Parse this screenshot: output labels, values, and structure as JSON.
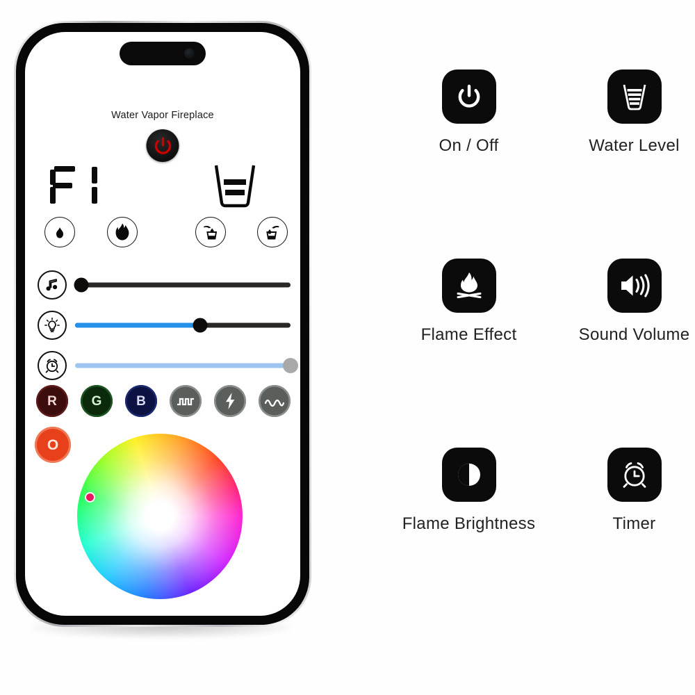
{
  "app": {
    "title": "Water Vapor Fireplace",
    "power_button": {
      "name": "power",
      "glyph": "power-icon",
      "color": "#cc0000"
    },
    "display": {
      "value": "F1",
      "type": "seven-segment"
    },
    "water_level_indicator": {
      "bars": 2,
      "max_bars": 3,
      "icon": "glass-water-level-icon"
    },
    "icon_buttons": [
      {
        "id": "flame-low",
        "icon": "small-flame-icon",
        "label": ""
      },
      {
        "id": "flame-high",
        "icon": "large-flame-icon",
        "label": ""
      },
      {
        "id": "water-decrease",
        "icon": "water-drop-into-glass-icon",
        "label": ""
      },
      {
        "id": "water-increase",
        "icon": "water-pour-out-glass-icon",
        "label": ""
      }
    ],
    "sliders": [
      {
        "id": "sound-volume",
        "icon": "music-note-icon",
        "value": 3,
        "min": 0,
        "max": 100,
        "track_color": "#2b2724",
        "fill_color": "#2490e8",
        "thumb_color": "#0d0c0b"
      },
      {
        "id": "flame-brightness",
        "icon": "light-bulb-icon",
        "value": 58,
        "min": 0,
        "max": 100,
        "track_color": "#2b2724",
        "fill_color": "#2490e8",
        "thumb_color": "#0d0c0b"
      },
      {
        "id": "timer",
        "icon": "alarm-clock-icon",
        "value": 100,
        "min": 0,
        "max": 100,
        "track_color": "#9ec4f0",
        "fill_color": "#9ec4f0",
        "thumb_color": "#a9a9a9"
      }
    ],
    "color_modes": [
      {
        "id": "red",
        "label": "R",
        "bg": "#3d0d0d",
        "ring": "#5e1a1a",
        "text": "#f0d8d8"
      },
      {
        "id": "green",
        "label": "G",
        "bg": "#0b2a0b",
        "ring": "#1d5422",
        "text": "#d8f0d8"
      },
      {
        "id": "blue",
        "label": "B",
        "bg": "#0c1242",
        "ring": "#1b2a6e",
        "text": "#d8dcf5"
      },
      {
        "id": "square-wave",
        "label": "",
        "bg": "#5a5f5c",
        "ring": "#8b908d",
        "text": "#ffffff",
        "icon": "square-wave-icon"
      },
      {
        "id": "flash",
        "label": "",
        "bg": "#5a5f5c",
        "ring": "#8b908d",
        "text": "#ffffff",
        "icon": "lightning-bolt-icon"
      },
      {
        "id": "sine-wave",
        "label": "",
        "bg": "#5a5f5c",
        "ring": "#8b908d",
        "text": "#ffffff",
        "icon": "sine-wave-icon"
      }
    ],
    "color_mode_selected": {
      "id": "orange",
      "label": "O",
      "bg": "#e8401a",
      "ring": "#f07a55",
      "text": "#ffe8d8"
    },
    "color_wheel": {
      "name": "hue-saturation-wheel",
      "handle": {
        "x_pct": 8,
        "y_pct": 38,
        "color": "#e81a5c"
      }
    }
  },
  "legend": {
    "items": [
      {
        "id": "on-off",
        "label": "On / Off",
        "icon": "power-icon"
      },
      {
        "id": "water-level",
        "label": "Water Level",
        "icon": "glass-water-level-icon"
      },
      {
        "id": "flame-effect",
        "label": "Flame Effect",
        "icon": "campfire-icon"
      },
      {
        "id": "sound-volume",
        "label": "Sound Volume",
        "icon": "speaker-volume-icon"
      },
      {
        "id": "flame-brightness",
        "label": "Flame Brightness",
        "icon": "contrast-half-circle-icon"
      },
      {
        "id": "timer",
        "label": "Timer",
        "icon": "alarm-clock-icon"
      }
    ],
    "tile_color": "#0b0b0b",
    "label_color": "#222222"
  }
}
